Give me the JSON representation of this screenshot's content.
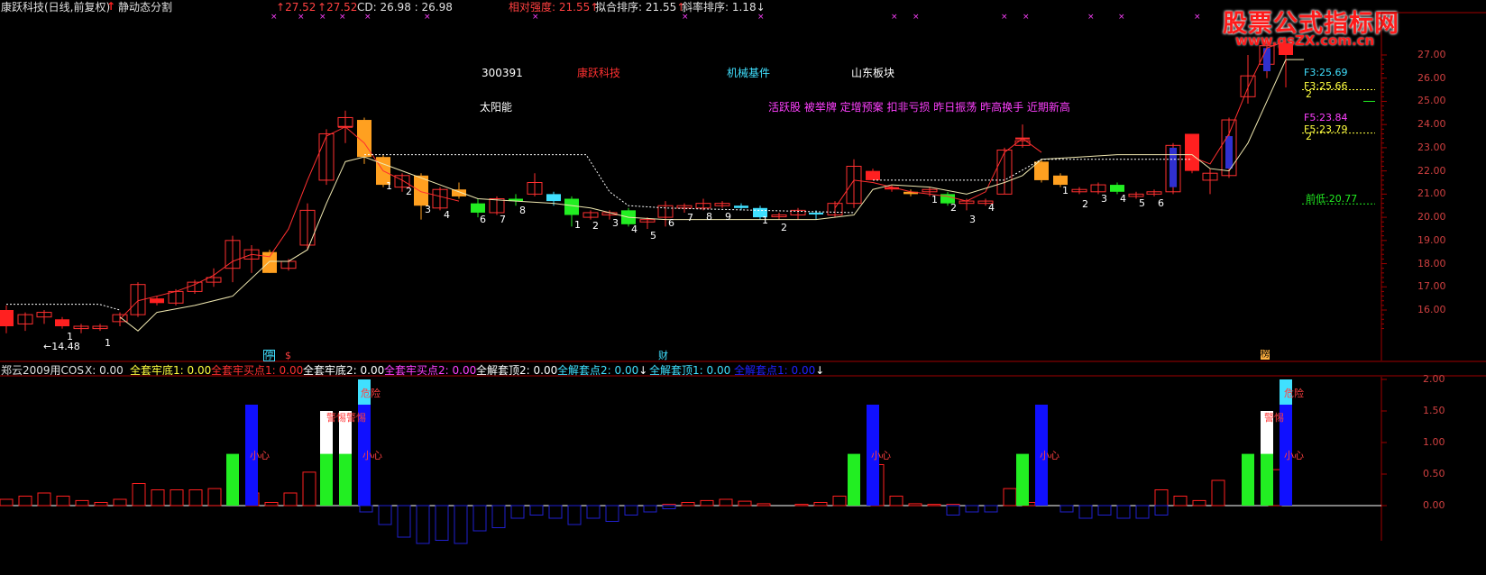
{
  "header": {
    "title": "康跃科技(日线,前复权)",
    "mode": "静动态分割",
    "p1": "27.52",
    "p2": "27.52",
    "cd": "CD: 26.98",
    "cd2": ": 26.98",
    "rel": "相对强度: 21.55",
    "fit": "拟合排序: 21.55",
    "slope": "斜率排序: 1.18"
  },
  "logo": {
    "main": "股票公式指标网",
    "url": "www.gsZX.com.cn"
  },
  "info": {
    "code": "300391",
    "name": "康跃科技",
    "industry": "机械基件",
    "region": "山东板块",
    "concept": "太阳能",
    "tags": "活跃股 被举牌 定增预案 扣非亏损 昨日振荡 昨高换手 近期新高"
  },
  "price_axis": [
    "27.00",
    "26.00",
    "25.00",
    "24.00",
    "23.00",
    "22.00",
    "21.00",
    "20.00",
    "19.00",
    "18.00",
    "17.00",
    "16.00"
  ],
  "price_annotations": {
    "low_mark": "←14.48",
    "f3a": "F3:25.69",
    "f3b": "F3:25.66",
    "f3c": "2",
    "f5a": "F5:23.84",
    "f5b": "F5:23.79",
    "f5c": "2",
    "prev_low": "前低:20.77"
  },
  "event_markers": {
    "m1": "停",
    "m2": "$",
    "m3": "财",
    "m4": "榜"
  },
  "candle_counts": {
    "g1": [
      "1",
      "1"
    ],
    "g2": [
      "1",
      "2",
      "3",
      "4"
    ],
    "g3": [
      "6",
      "7",
      "8"
    ],
    "g4": [
      "1",
      "2",
      "3",
      "4",
      "5",
      "6",
      "7",
      "8",
      "9"
    ],
    "g5": [
      "1",
      "2"
    ],
    "g6": [
      "1",
      "2",
      "3",
      "4"
    ],
    "g7": [
      "1",
      "2",
      "3",
      "4",
      "5",
      "6"
    ]
  },
  "indicator": {
    "name": "郑云2009用COS",
    "x": "X: 0.00",
    "f1": "全套牢底1: 0.00",
    "f2": "全套牢买点1: 0.00",
    "f3": "全套牢底2: 0.00",
    "f4": "全套牢买点2: 0.00",
    "f5": "全解套顶2: 0.00",
    "f6": "全解套点2: 0.00",
    "f7": "全解套顶1: 0.00",
    "f8": "全解套点1: 0.00"
  },
  "sub_axis": [
    "2.00",
    "1.50",
    "1.00",
    "0.50",
    "0.00"
  ],
  "sub_labels": {
    "danger": "危险",
    "alert": "警惕",
    "careful": "小心"
  },
  "colors": {
    "up": "#ff2020",
    "down_green": "#22ee22",
    "orange": "#ffa020",
    "cyan": "#40e0ff",
    "blue": "#1010ff",
    "magenta": "#ff40ff",
    "yellow": "#ffff40",
    "grid": "#7a0000"
  }
}
